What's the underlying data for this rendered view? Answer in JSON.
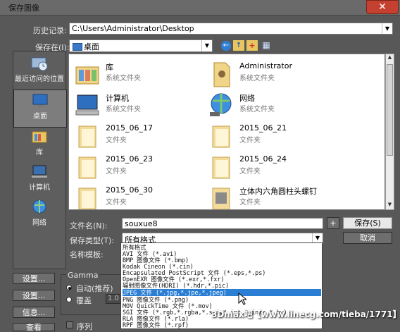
{
  "window": {
    "title": "保存图像",
    "close_symbol": "✕"
  },
  "history": {
    "label": "历史记录:",
    "value": "C:\\Users\\Administrator\\Desktop"
  },
  "save_in": {
    "label": "保存在(I):",
    "value": "桌面"
  },
  "toolbar": {
    "back": "←",
    "up": "↑",
    "new_folder": "+",
    "views": "▦"
  },
  "places": [
    {
      "label": "最近访问的位置"
    },
    {
      "label": "桌面"
    },
    {
      "label": "库"
    },
    {
      "label": "计算机"
    },
    {
      "label": "网络"
    }
  ],
  "files": [
    {
      "name": "库",
      "type": "系统文件夹"
    },
    {
      "name": "Administrator",
      "type": "系统文件夹"
    },
    {
      "name": "计算机",
      "type": "系统文件夹"
    },
    {
      "name": "网络",
      "type": "系统文件夹"
    },
    {
      "name": "2015_06_17",
      "type": "文件夹"
    },
    {
      "name": "2015_06_21",
      "type": "文件夹"
    },
    {
      "name": "2015_06_23",
      "type": "文件夹"
    },
    {
      "name": "2015_06_24",
      "type": "文件夹"
    },
    {
      "name": "2015_06_30",
      "type": "文件夹"
    },
    {
      "name": "立体内六角圆柱头螺钉",
      "type": "文件夹"
    }
  ],
  "filename": {
    "label": "文件名(N):",
    "value": "souxue8",
    "plus": "+",
    "save_button": "保存(S)"
  },
  "filetype": {
    "label": "保存类型(T):",
    "value": "所有格式",
    "cancel_button": "取消"
  },
  "template": {
    "label": "名称模板:"
  },
  "dropdown": {
    "options": [
      "所有格式",
      "AVI 文件 (*.avi)",
      "BMP 图像文件 (*.bmp)",
      "Kodak Cineon (*.cin)",
      "Encapsulated PostScript 文件 (*.eps,*.ps)",
      "OpenEXR 图像文件 (*.exr,*.fxr)",
      "辐射图像文件(HDRI) (*.hdr,*.pic)",
      "JPEG 文件 (*.jpg,*.jpe,*.jpeg)",
      "PNG 图像文件 (*.png)",
      "MOV QuickTime 文件 (*.mov)",
      "SGI 文件 (*.rgb,*.rgba,*.sgi,*.int,*.inta,*.bw)",
      "RLA 图像文件 (*.rla)",
      "RPF 图像文件 (*.rpf)"
    ],
    "selected_index": 7
  },
  "lower_left": {
    "setup": "设置...",
    "settings": "设置...",
    "info": "信息...",
    "view": "查看"
  },
  "gamma": {
    "label": "Gamma",
    "auto": "自动(推荐)",
    "override": "覆盖",
    "override_value": "1.0"
  },
  "sequence": {
    "label": "序列"
  },
  "watermark": "3Dmax吧【www.linecg.com/tieba/1771】",
  "colors": {
    "highlight": "#2a7fd4",
    "title_bar": "#6a6a6a",
    "close_button": "#c44030",
    "panel": "#585858"
  }
}
